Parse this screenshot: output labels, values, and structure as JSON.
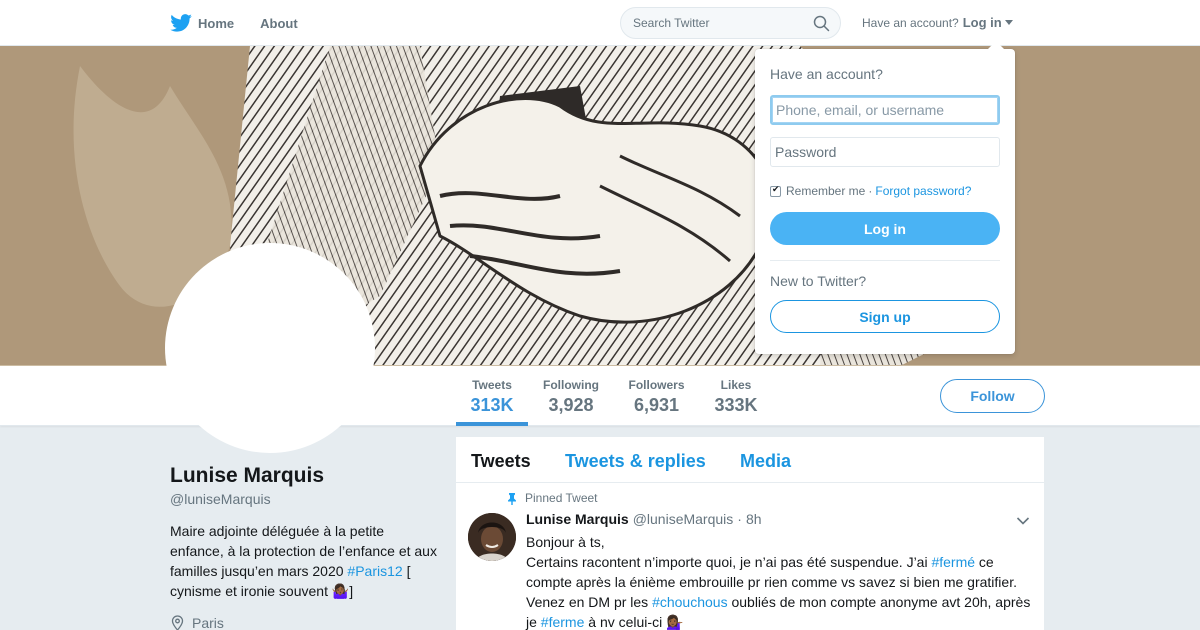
{
  "nav": {
    "home": "Home",
    "about": "About",
    "search_placeholder": "Search Twitter",
    "have_account": "Have an account?",
    "login": "Log in"
  },
  "profile": {
    "name": "Lunise Marquis",
    "handle": "@luniseMarquis",
    "bio_line": "Maire adjointe déléguée à la petite enfance, à la protection de l’enfance et aux familles jusqu’en mars 2020",
    "bio_tag": "#Paris12",
    "bio_tail": " [ cynisme et ironie souvent 🤷🏾‍♀️]",
    "location": "Paris",
    "follow_label": "Follow"
  },
  "stats": [
    {
      "label": "Tweets",
      "value": "313K"
    },
    {
      "label": "Following",
      "value": "3,928"
    },
    {
      "label": "Followers",
      "value": "6,931"
    },
    {
      "label": "Likes",
      "value": "333K"
    }
  ],
  "tabs": [
    "Tweets",
    "Tweets & replies",
    "Media"
  ],
  "tweet": {
    "pinned": "Pinned Tweet",
    "name": "Lunise Marquis",
    "handle": "@luniseMarquis",
    "time": "8h",
    "line1": "Bonjour à ts,",
    "p1": "Certains racontent n’importe quoi, je n’ai pas été suspendue. J’ai ",
    "tag1": "#fermé",
    "p2": " ce compte après la énième embrouille pr rien comme vs savez si bien me gratifier. Venez en DM pr les ",
    "tag2": "#chouchous",
    "p3": " oubliés de mon compte anonyme avt 20h, après je ",
    "tag3": "#ferme",
    "p4": " à nv celui-ci 💁🏾‍♀️"
  },
  "login_dropdown": {
    "heading": "Have an account?",
    "username_placeholder": "Phone, email, or username",
    "password_placeholder": "Password",
    "remember": "Remember me",
    "separator": "·",
    "forgot": "Forgot password?",
    "login_button": "Log in",
    "new_heading": "New to Twitter?",
    "signup_button": "Sign up"
  },
  "colors": {
    "accent": "#1b95e0",
    "login_button": "#4ab3f4",
    "background": "#e6ecf0"
  }
}
